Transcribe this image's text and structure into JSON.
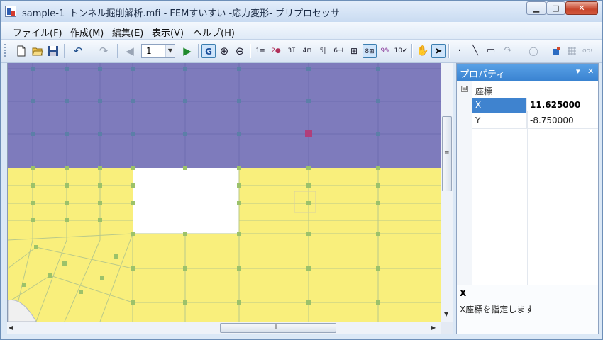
{
  "window": {
    "title": "sample-1_トンネル掘削解析.mfi - FEMすいすい -応力変形- プリプロセッサ",
    "minimize_glyph": "▁",
    "maximize_glyph": "□",
    "close_glyph": "✕"
  },
  "menu": {
    "items": [
      "ファイル(F)",
      "作成(M)",
      "編集(E)",
      "表示(V)",
      "ヘルプ(H)"
    ]
  },
  "toolbar": {
    "page_value": "1",
    "page_dropdown_glyph": "▼",
    "view_g_label": "G",
    "buttons": [
      {
        "icon": "new-file-icon",
        "glyph": "🗋"
      },
      {
        "icon": "open-folder-icon",
        "glyph": "📂"
      },
      {
        "icon": "save-icon",
        "glyph": "💾"
      },
      {
        "icon": "undo-icon",
        "glyph": "↶"
      },
      {
        "icon": "redo-icon",
        "glyph": "↷"
      },
      {
        "icon": "previous-step-icon",
        "glyph": "◀"
      },
      {
        "icon": "next-step-icon",
        "glyph": "▶"
      }
    ],
    "tool_glyphs": {
      "zoom_in": "⊕",
      "zoom_out": "⊖",
      "pan": "✋",
      "select": "➤",
      "point": "·",
      "line": "╲",
      "rect": "▭",
      "arc": "↷",
      "circle": "◯",
      "run": "GO!"
    },
    "numbered_tools": [
      "1≡",
      "2●",
      "3⌶",
      "4⊓",
      "5|",
      "6⊣",
      "⊞",
      "8⊞",
      "9✎",
      "10✔"
    ]
  },
  "properties": {
    "title": "プロパティ",
    "pin_glyph": "▾",
    "close_glyph": "✕",
    "category": "座標",
    "category_toggle": "⊟",
    "rows": [
      {
        "name": "X",
        "value": "11.625000",
        "selected": true
      },
      {
        "name": "Y",
        "value": "-8.750000",
        "selected": false
      }
    ],
    "description_title": "X",
    "description_text": "X座標を指定します"
  },
  "scrollbar": {
    "grip": "≡",
    "hgrip": "⦀",
    "up": "▲",
    "down": "▼",
    "left": "◀",
    "right": "▶"
  },
  "colors": {
    "upper_region": "#7e7bbc",
    "lower_region": "#f9ef7c",
    "node": "#5c7fa8",
    "selected_node": "#b03f7b",
    "mesh_line": "#9cc0a2"
  }
}
